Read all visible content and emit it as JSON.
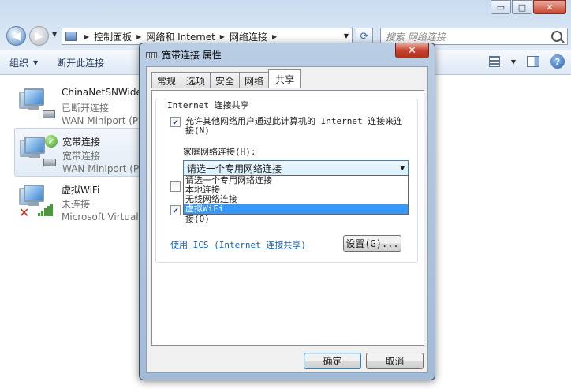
{
  "explorer": {
    "caption_buttons": [
      "▭",
      "□",
      "✕"
    ],
    "breadcrumb": [
      "控制面板",
      "网络和 Internet",
      "网络连接"
    ],
    "search_placeholder": "搜索 网络连接",
    "commands": {
      "organize": "组织",
      "disconnect": "断开此连接"
    },
    "connections": [
      {
        "name": "ChinaNetSNWide",
        "status": "已断开连接",
        "device": "WAN Miniport (P"
      },
      {
        "name": "宽带连接",
        "status": "宽带连接",
        "device": "WAN Miniport (P"
      },
      {
        "name": "虚拟WiFi",
        "status": "未连接",
        "device": "Microsoft Virtual"
      }
    ]
  },
  "dialog": {
    "title": "宽带连接 属性",
    "close": "✕",
    "tabs": [
      "常规",
      "选项",
      "安全",
      "网络",
      "共享"
    ],
    "active_tab": "共享",
    "group_title": "Internet 连接共享",
    "allow_sharing_label": "允许其他网络用户通过此计算机的 Internet 连接来连接(N)",
    "allow_sharing_checked": true,
    "home_network_label": "家庭网络连接(H):",
    "combo_value": "请选一个专用网络连接",
    "dropdown_options": [
      "请选一个专用网络连接",
      "本地连接",
      "无线网络连接",
      "虚拟WiFi"
    ],
    "dropdown_highlighted": "虚拟WiFi",
    "second_checkbox_checked": false,
    "third_checkbox_label": "接(O)",
    "third_checkbox_checked": true,
    "ics_link": "使用 ICS (Internet 连接共享)",
    "settings_button": "设置(G)...",
    "ok_button": "确定",
    "cancel_button": "取消"
  }
}
